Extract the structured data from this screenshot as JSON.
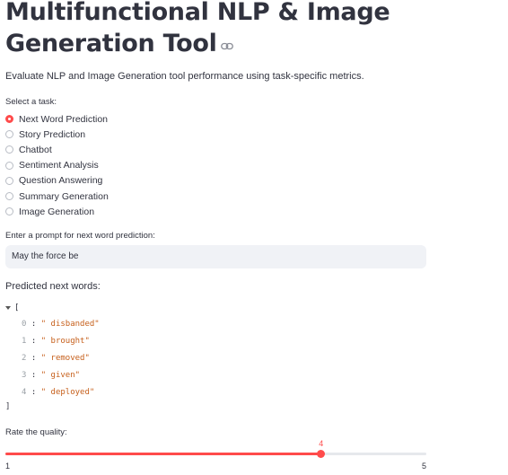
{
  "header": {
    "title": "Multifunctional NLP & Image Generation Tool",
    "description": "Evaluate NLP and Image Generation tool performance using task-specific metrics."
  },
  "task": {
    "label": "Select a task:",
    "selected_index": 0,
    "options": [
      {
        "label": "Next Word Prediction"
      },
      {
        "label": "Story Prediction"
      },
      {
        "label": "Chatbot"
      },
      {
        "label": "Sentiment Analysis"
      },
      {
        "label": "Question Answering"
      },
      {
        "label": "Summary Generation"
      },
      {
        "label": "Image Generation"
      }
    ]
  },
  "prompt": {
    "label": "Enter a prompt for next word prediction:",
    "value": "May the force be"
  },
  "prediction": {
    "label": "Predicted next words:",
    "open_bracket": "[",
    "close_bracket": "]",
    "items": [
      {
        "index": "0",
        "value": "\" disbanded\""
      },
      {
        "index": "1",
        "value": "\" brought\""
      },
      {
        "index": "2",
        "value": "\" removed\""
      },
      {
        "index": "3",
        "value": "\" given\""
      },
      {
        "index": "4",
        "value": "\" deployed\""
      }
    ]
  },
  "rating": {
    "label": "Rate the quality:",
    "min": 1,
    "max": 5,
    "value": 4,
    "min_label": "1",
    "max_label": "5",
    "value_label": "4"
  },
  "colors": {
    "accent": "#ff4b4b",
    "json_string": "#c65f1b",
    "input_bg": "#f0f2f6"
  }
}
